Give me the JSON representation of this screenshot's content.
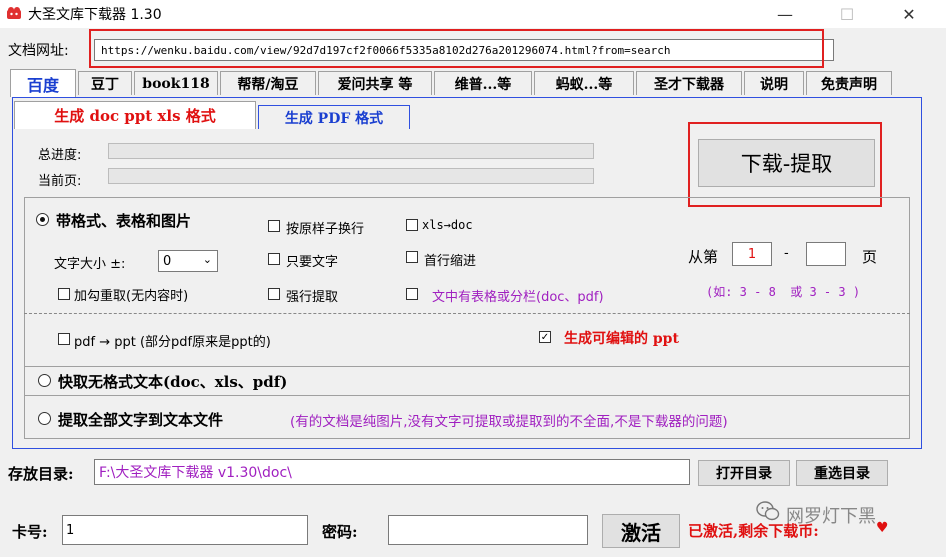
{
  "window": {
    "title": "大圣文库下载器 1.30",
    "minimize_glyph": "—",
    "maximize_glyph": "☐",
    "close_glyph": "✕"
  },
  "url": {
    "label": "文档网址:",
    "value": "https://wenku.baidu.com/view/92d7d197cf2f0066f5335a8102d276a201296074.html?from=search"
  },
  "tabs": [
    "百度",
    "豆丁",
    "book118",
    "帮帮/淘豆",
    "爱问共享 等",
    "维普...等",
    "蚂蚁...等",
    "圣才下载器",
    "说明",
    "免责声明"
  ],
  "subtabs": [
    "生成 doc ppt xls 格式",
    "生成 PDF 格式"
  ],
  "progress": {
    "total_label": "总进度:",
    "current_label": "当前页:",
    "total_value": 0,
    "current_value": 0
  },
  "download_button": "下载-提取",
  "options": {
    "radio_format": "带格式、表格和图片",
    "font_size_label": "文字大小 ±:",
    "font_size_value": "0",
    "add_check": "加勾重取(无内容时)",
    "keep_newline": "按原样子换行",
    "text_only": "只要文字",
    "force_extract": "强行提取",
    "xls_doc": "xls→doc",
    "first_indent": "首行缩进",
    "table_cols": "文中有表格或分栏(doc、pdf)",
    "from_label": "从第",
    "from_value": "1",
    "dash": "-",
    "to_value": "",
    "page_label": "页",
    "example": "(如: 3 - 8  或 3 - 3 )",
    "pdf_ppt": "pdf → ppt (部分pdf原来是ppt的)",
    "editable_ppt": "生成可编辑的 ppt",
    "check_mark": "✓",
    "radio_fast": "快取无格式文本(doc、xls、pdf)",
    "radio_all": "提取全部文字到文本文件",
    "note": "(有的文档是纯图片,没有文字可提取或提取到的不全面,不是下载器的问题)"
  },
  "save": {
    "label": "存放目录:",
    "value": "F:\\大圣文库下载器 v1.30\\doc\\",
    "open_button": "打开目录",
    "reselect_button": "重选目录"
  },
  "activation": {
    "card_label": "卡号:",
    "card_value": "1",
    "password_label": "密码:",
    "password_value": "",
    "activate_button": "激活",
    "status": "已激活,剩余下载币:",
    "heart": "♥"
  },
  "watermark": "网罗灯下黑",
  "colors": {
    "accent_blue": "#1a3fd0",
    "red": "#e01010",
    "purple": "#a020c0"
  }
}
